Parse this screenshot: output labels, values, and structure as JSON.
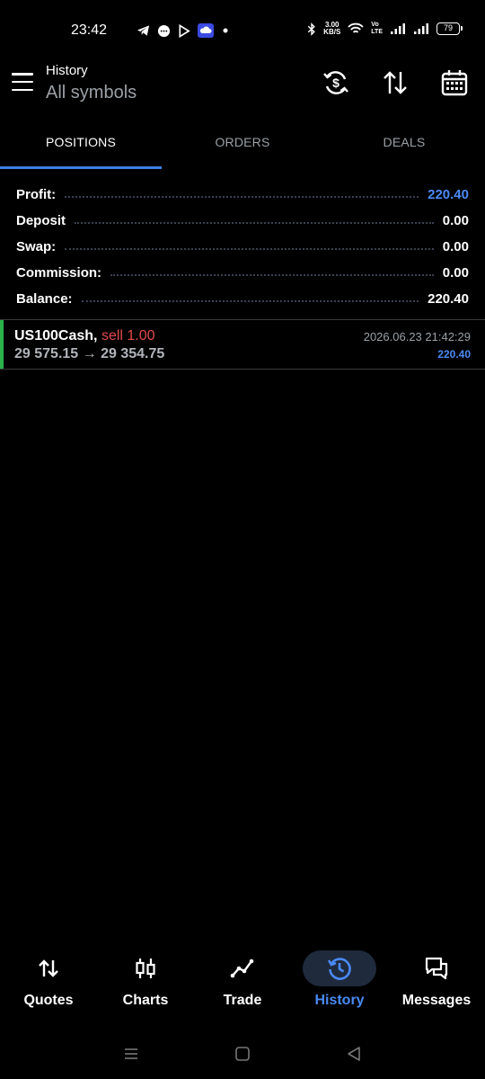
{
  "status_bar": {
    "time": "23:42",
    "network_speed_value": "3.00",
    "network_speed_unit": "KB/S",
    "volte": "Vo\nLTE",
    "battery": "79",
    "icons": [
      "telegram-icon",
      "chat-icon",
      "play-icon",
      "cloud-app-icon",
      "dot-icon",
      "bluetooth-icon",
      "wifi-icon",
      "signal-icon",
      "signal-icon"
    ]
  },
  "header": {
    "title": "History",
    "subtitle": "All symbols",
    "actions": [
      "currency-sync-icon",
      "sort-icon",
      "calendar-icon"
    ]
  },
  "tabs": [
    {
      "label": "POSITIONS",
      "active": true
    },
    {
      "label": "ORDERS",
      "active": false
    },
    {
      "label": "DEALS",
      "active": false
    }
  ],
  "summary": [
    {
      "label": "Profit:",
      "value": "220.40",
      "color": "#4a8af4"
    },
    {
      "label": "Deposit",
      "value": "0.00"
    },
    {
      "label": "Swap:",
      "value": "0.00"
    },
    {
      "label": "Commission:",
      "value": "0.00"
    },
    {
      "label": "Balance:",
      "value": "220.40"
    }
  ],
  "positions": [
    {
      "symbol": "US100Cash,",
      "side": "sell 1.00",
      "open_price": "29 575.15",
      "arrow": "→",
      "close_price": "29 354.75",
      "time": "2026.06.23 21:42:29",
      "profit": "220.40"
    }
  ],
  "bottom_nav": [
    {
      "label": "Quotes",
      "icon": "quotes-icon",
      "active": false
    },
    {
      "label": "Charts",
      "icon": "charts-icon",
      "active": false
    },
    {
      "label": "Trade",
      "icon": "trade-icon",
      "active": false
    },
    {
      "label": "History",
      "icon": "history-icon",
      "active": true
    },
    {
      "label": "Messages",
      "icon": "messages-icon",
      "active": false
    }
  ],
  "colors": {
    "accent": "#4a8af4",
    "sell": "#e44b4b",
    "buy_bar": "#2bb24c",
    "background": "#000000"
  }
}
